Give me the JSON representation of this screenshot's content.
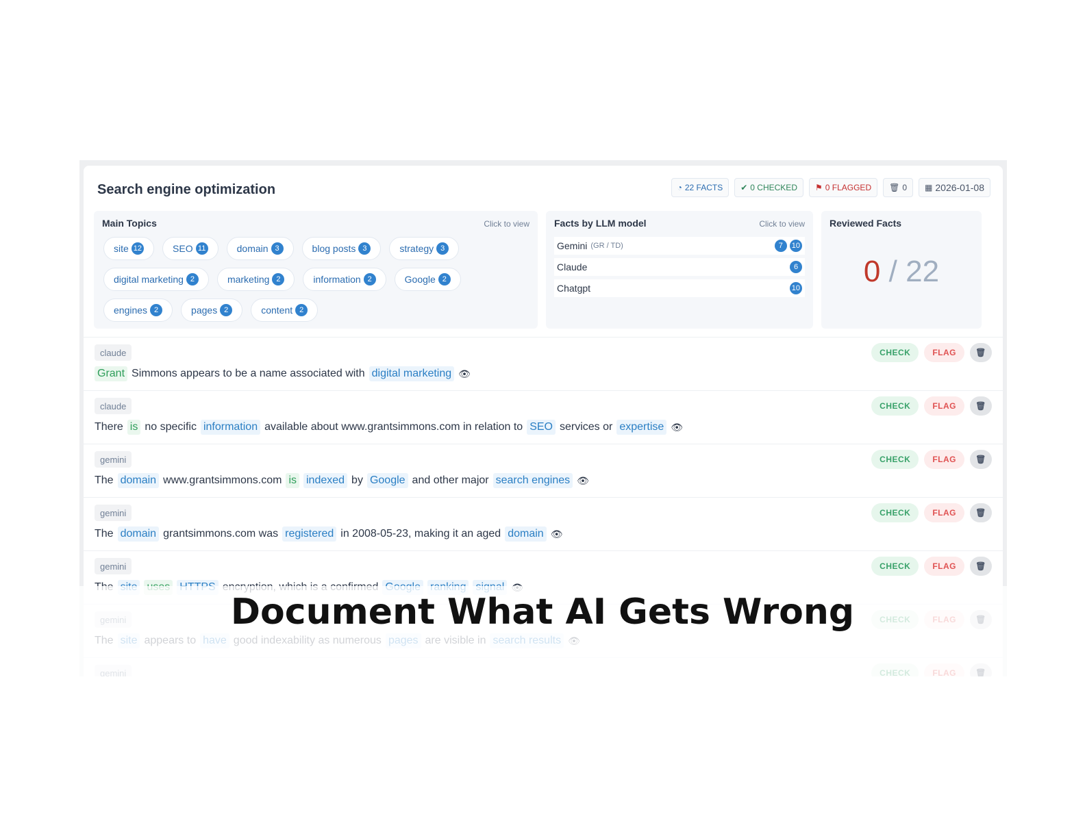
{
  "header": {
    "title": "Search engine optimization",
    "badges": {
      "facts": "22 FACTS",
      "checked": "0 CHECKED",
      "flagged": "0 FLAGGED",
      "trash": "0",
      "date": "2026-01-08"
    }
  },
  "topics_panel": {
    "title": "Main Topics",
    "hint": "Click to view",
    "topics": [
      {
        "label": "site",
        "count": "12"
      },
      {
        "label": "SEO",
        "count": "11"
      },
      {
        "label": "domain",
        "count": "3"
      },
      {
        "label": "blog posts",
        "count": "3"
      },
      {
        "label": "strategy",
        "count": "3"
      },
      {
        "label": "digital marketing",
        "count": "2"
      },
      {
        "label": "marketing",
        "count": "2"
      },
      {
        "label": "information",
        "count": "2"
      },
      {
        "label": "Google",
        "count": "2"
      },
      {
        "label": "engines",
        "count": "2"
      },
      {
        "label": "pages",
        "count": "2"
      },
      {
        "label": "content",
        "count": "2"
      }
    ]
  },
  "llm_panel": {
    "title": "Facts by LLM model",
    "hint": "Click to view",
    "rows": [
      {
        "name": "Gemini",
        "sub": "(GR / TD)",
        "counts": [
          "7",
          "10"
        ]
      },
      {
        "name": "Claude",
        "sub": "",
        "counts": [
          "6"
        ]
      },
      {
        "name": "Chatgpt",
        "sub": "",
        "counts": [
          "10"
        ]
      }
    ]
  },
  "reviewed_panel": {
    "title": "Reviewed Facts",
    "done": "0",
    "separator": "/",
    "total": "22"
  },
  "fact_actions": {
    "check": "CHECK",
    "flag": "FLAG"
  },
  "facts": [
    {
      "model": "claude",
      "segments": [
        {
          "t": "Grant",
          "h": "green"
        },
        {
          "t": "Simmons appears to be a name associated with",
          "h": ""
        },
        {
          "t": "digital marketing",
          "h": "blue"
        }
      ]
    },
    {
      "model": "claude",
      "segments": [
        {
          "t": "There",
          "h": ""
        },
        {
          "t": "is",
          "h": "green"
        },
        {
          "t": "no specific",
          "h": ""
        },
        {
          "t": "information",
          "h": "blue"
        },
        {
          "t": "available about www.grantsimmons.com in relation to",
          "h": ""
        },
        {
          "t": "SEO",
          "h": "blue"
        },
        {
          "t": "services or",
          "h": ""
        },
        {
          "t": "expertise",
          "h": "blue"
        }
      ]
    },
    {
      "model": "gemini",
      "segments": [
        {
          "t": "The",
          "h": ""
        },
        {
          "t": "domain",
          "h": "blue"
        },
        {
          "t": "www.grantsimmons.com",
          "h": ""
        },
        {
          "t": "is",
          "h": "green"
        },
        {
          "t": "indexed",
          "h": "blue"
        },
        {
          "t": "by",
          "h": ""
        },
        {
          "t": "Google",
          "h": "blue"
        },
        {
          "t": "and other major",
          "h": ""
        },
        {
          "t": "search engines",
          "h": "blue"
        }
      ]
    },
    {
      "model": "gemini",
      "segments": [
        {
          "t": "The",
          "h": ""
        },
        {
          "t": "domain",
          "h": "blue"
        },
        {
          "t": "grantsimmons.com was",
          "h": ""
        },
        {
          "t": "registered",
          "h": "blue"
        },
        {
          "t": "in 2008-05-23, making it an aged",
          "h": ""
        },
        {
          "t": "domain",
          "h": "blue"
        }
      ]
    },
    {
      "model": "gemini",
      "segments": [
        {
          "t": "The",
          "h": ""
        },
        {
          "t": "site",
          "h": "blue"
        },
        {
          "t": "uses",
          "h": "green"
        },
        {
          "t": "HTTPS",
          "h": "blue"
        },
        {
          "t": "encryption, which is a confirmed",
          "h": ""
        },
        {
          "t": "Google",
          "h": "blue"
        },
        {
          "t": "ranking",
          "h": "blue"
        },
        {
          "t": "signal",
          "h": "blue"
        }
      ]
    },
    {
      "model": "gemini",
      "segments": [
        {
          "t": "The",
          "h": ""
        },
        {
          "t": "site",
          "h": "blue"
        },
        {
          "t": "appears to",
          "h": ""
        },
        {
          "t": "have",
          "h": "blue"
        },
        {
          "t": "good indexability as numerous",
          "h": ""
        },
        {
          "t": "pages",
          "h": "blue"
        },
        {
          "t": "are visible in",
          "h": ""
        },
        {
          "t": "search results",
          "h": "blue"
        }
      ]
    },
    {
      "model": "gemini",
      "segments": []
    }
  ],
  "caption": "Document What AI Gets Wrong"
}
